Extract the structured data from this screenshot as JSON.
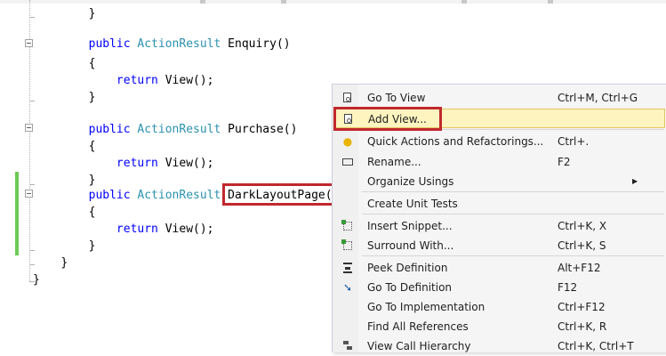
{
  "editor": {
    "lines": [
      {
        "id": "l1",
        "indent": "        ",
        "parts": [
          {
            "t": "}",
            "c": ""
          }
        ]
      },
      {
        "id": "l2",
        "indent": "        ",
        "parts": [
          {
            "t": "public ",
            "c": "kw"
          },
          {
            "t": "ActionResult",
            "c": "ty"
          },
          {
            "t": " Enquiry()",
            "c": ""
          }
        ]
      },
      {
        "id": "l3",
        "indent": "        ",
        "parts": [
          {
            "t": "{",
            "c": ""
          }
        ]
      },
      {
        "id": "l4",
        "indent": "            ",
        "parts": [
          {
            "t": "return ",
            "c": "kw"
          },
          {
            "t": "View();",
            "c": ""
          }
        ]
      },
      {
        "id": "l5",
        "indent": "        ",
        "parts": [
          {
            "t": "}",
            "c": ""
          }
        ]
      },
      {
        "id": "l6",
        "indent": "        ",
        "parts": [
          {
            "t": "public ",
            "c": "kw"
          },
          {
            "t": "ActionResult",
            "c": "ty"
          },
          {
            "t": " Purchase()",
            "c": ""
          }
        ]
      },
      {
        "id": "l7",
        "indent": "        ",
        "parts": [
          {
            "t": "{",
            "c": ""
          }
        ]
      },
      {
        "id": "l8",
        "indent": "            ",
        "parts": [
          {
            "t": "return ",
            "c": "kw"
          },
          {
            "t": "View();",
            "c": ""
          }
        ]
      },
      {
        "id": "l9",
        "indent": "        ",
        "parts": [
          {
            "t": "}",
            "c": ""
          }
        ]
      },
      {
        "id": "l10",
        "indent": "        ",
        "parts": [
          {
            "t": "public ",
            "c": "kw"
          },
          {
            "t": "ActionResult",
            "c": "ty"
          },
          {
            "t": " DarkLayoutPage(",
            "c": ""
          }
        ]
      },
      {
        "id": "l11",
        "indent": "        ",
        "parts": [
          {
            "t": "{",
            "c": ""
          }
        ]
      },
      {
        "id": "l12",
        "indent": "            ",
        "parts": [
          {
            "t": "return ",
            "c": "kw"
          },
          {
            "t": "View();",
            "c": ""
          }
        ]
      },
      {
        "id": "l13",
        "indent": "        ",
        "parts": [
          {
            "t": "}",
            "c": ""
          }
        ]
      },
      {
        "id": "l14",
        "indent": "    ",
        "parts": [
          {
            "t": "}",
            "c": ""
          }
        ]
      },
      {
        "id": "l15",
        "indent": "",
        "parts": [
          {
            "t": "}",
            "c": ""
          }
        ]
      }
    ]
  },
  "context_menu": {
    "items": [
      {
        "label": "Go To View",
        "shortcut": "Ctrl+M, Ctrl+G",
        "icon": "document-icon"
      },
      {
        "label": "Add View...",
        "shortcut": "",
        "icon": "document-icon",
        "active": true
      },
      {
        "label": "Quick Actions and Refactorings...",
        "shortcut": "Ctrl+.",
        "icon": "lightbulb-icon"
      },
      {
        "label": "Rename...",
        "shortcut": "F2",
        "icon": "rename-icon"
      },
      {
        "label": "Organize Usings",
        "shortcut": "",
        "icon": "",
        "submenu": true
      },
      {
        "label": "Create Unit Tests",
        "shortcut": "",
        "icon": ""
      },
      {
        "label": "Insert Snippet...",
        "shortcut": "Ctrl+K, X",
        "icon": "snippet-icon"
      },
      {
        "label": "Surround With...",
        "shortcut": "Ctrl+K, S",
        "icon": "snippet-icon"
      },
      {
        "label": "Peek Definition",
        "shortcut": "Alt+F12",
        "icon": "peek-icon"
      },
      {
        "label": "Go To Definition",
        "shortcut": "F12",
        "icon": "go-to-definition-icon"
      },
      {
        "label": "Go To Implementation",
        "shortcut": "Ctrl+F12",
        "icon": ""
      },
      {
        "label": "Find All References",
        "shortcut": "Ctrl+K, R",
        "icon": ""
      },
      {
        "label": "View Call Hierarchy",
        "shortcut": "Ctrl+K, Ctrl+T",
        "icon": "hierarchy-icon"
      }
    ],
    "submenu_arrow": "▶",
    "lightbulb_glyph": "💡",
    "go_to_def_glyph": "⬆"
  },
  "colors": {
    "highlight_box": "#c0282d",
    "keyword": "#0000ff",
    "type": "#2b91af",
    "change_bar": "#6ccb55",
    "menu_active": "#fdf4bf"
  }
}
